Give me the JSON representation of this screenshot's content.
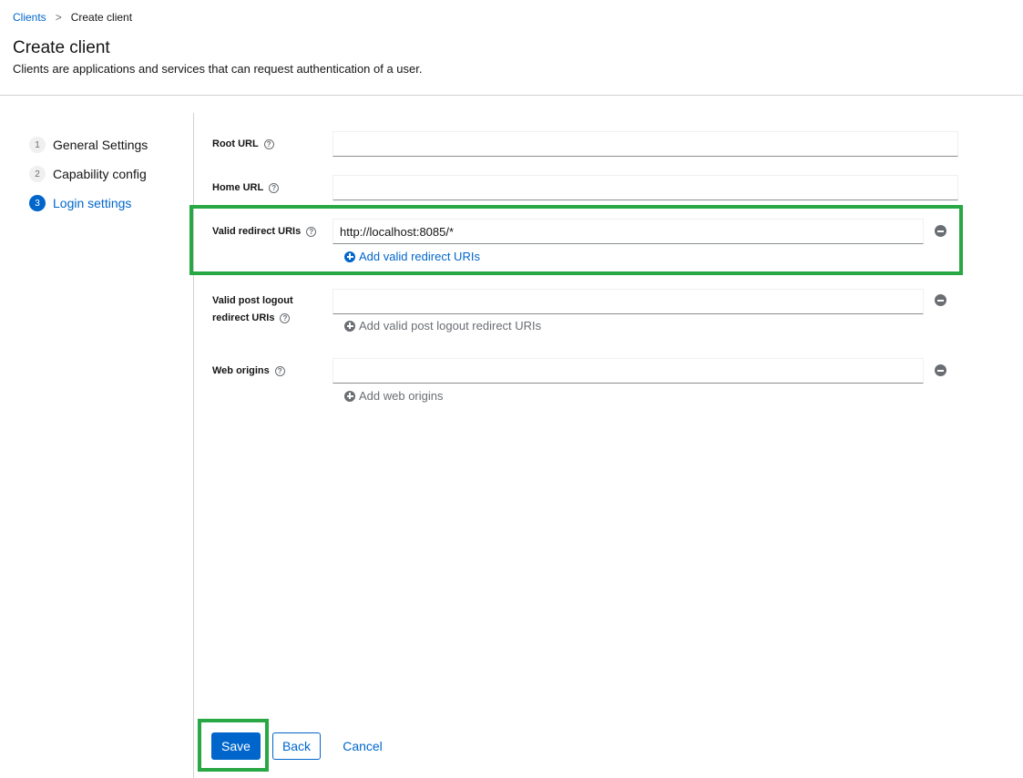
{
  "breadcrumb": {
    "parent": "Clients",
    "separator": ">",
    "current": "Create client"
  },
  "header": {
    "title": "Create client",
    "description": "Clients are applications and services that can request authentication of a user."
  },
  "wizard": {
    "steps": [
      {
        "number": "1",
        "label": "General Settings",
        "active": false
      },
      {
        "number": "2",
        "label": "Capability config",
        "active": false
      },
      {
        "number": "3",
        "label": "Login settings",
        "active": true
      }
    ]
  },
  "form": {
    "root_url": {
      "label": "Root URL",
      "value": ""
    },
    "home_url": {
      "label": "Home URL",
      "value": ""
    },
    "valid_redirect_uris": {
      "label": "Valid redirect URIs",
      "value": "http://localhost:8085/*",
      "add_label": "Add valid redirect URIs"
    },
    "valid_post_logout": {
      "label_line1": "Valid post logout",
      "label_line2": "redirect URIs",
      "value": "",
      "add_label": "Add valid post logout redirect URIs"
    },
    "web_origins": {
      "label": "Web origins",
      "value": "",
      "add_label": "Add web origins"
    },
    "help_glyph": "?"
  },
  "actions": {
    "save": "Save",
    "back": "Back",
    "cancel": "Cancel"
  },
  "colors": {
    "primary": "#0066cc",
    "highlight": "#28a745",
    "muted": "#6a6e73"
  }
}
